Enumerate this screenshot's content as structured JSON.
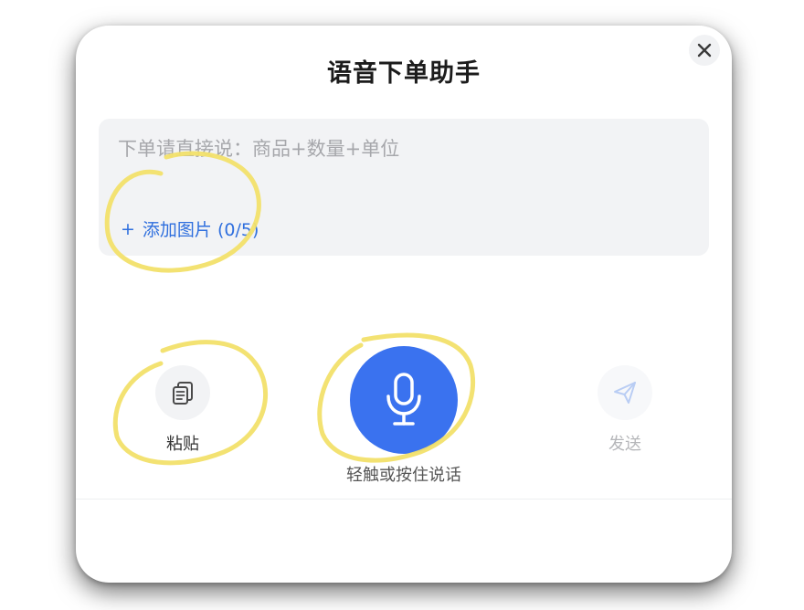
{
  "dialog": {
    "title": "语音下单助手",
    "close_icon": "close-icon"
  },
  "input": {
    "placeholder": "下单请直接说：商品+数量+单位",
    "add_image_label": "添加图片 (0/5)",
    "add_image_plus": "+"
  },
  "actions": {
    "paste_label": "粘贴",
    "paste_icon": "paste-icon",
    "mic_icon": "microphone-icon",
    "mic_label": "轻触或按住说话",
    "send_label": "发送",
    "send_icon": "send-icon"
  },
  "colors": {
    "accent_blue": "#3a72ef",
    "link_blue": "#2f6fde",
    "highlight_yellow": "#f2e06a"
  }
}
